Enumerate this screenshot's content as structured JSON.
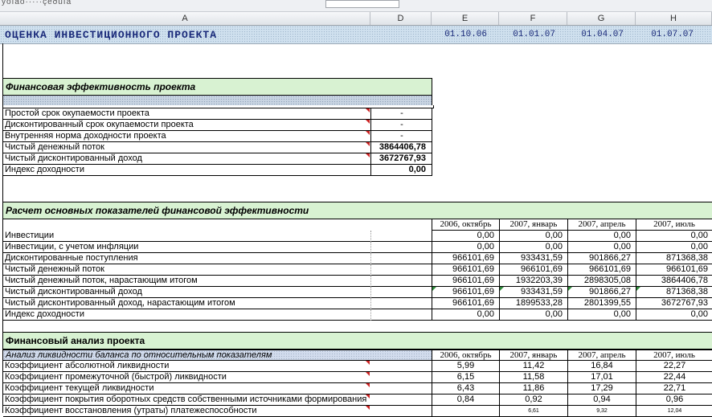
{
  "top_strip": {
    "dots": "ÿôíåô·····çèðûîå"
  },
  "column_headers": [
    {
      "id": "A",
      "label": "A"
    },
    {
      "id": "D",
      "label": "D"
    },
    {
      "id": "E",
      "label": "E"
    },
    {
      "id": "F",
      "label": "F"
    },
    {
      "id": "G",
      "label": "G"
    },
    {
      "id": "H",
      "label": "H"
    }
  ],
  "title_row": {
    "title": "ОЦЕНКА ИНВЕСТИЦИОННОГО ПРОЕКТА",
    "dates": [
      "01.10.06",
      "01.01.07",
      "01.04.07",
      "01.07.07"
    ]
  },
  "section1": {
    "heading": "Финансовая эффективность проекта",
    "rows": [
      {
        "label": "Простой срок окупаемости проекта",
        "value": "-"
      },
      {
        "label": "Дисконтированный срок окупаемости проекта",
        "value": "-"
      },
      {
        "label": "Внутренняя норма доходности проекта",
        "value": "-"
      },
      {
        "label": "Чистый денежный поток",
        "value": "3864406,78"
      },
      {
        "label": "Чистый дисконтированный доход",
        "value": "3672767,93"
      },
      {
        "label": "Индекс доходности",
        "value": "0,00"
      }
    ]
  },
  "section2": {
    "heading": "Расчет основных показателей финансовой эффективности",
    "periods": [
      "2006, октябрь",
      "2007, январь",
      "2007, апрель",
      "2007, июль"
    ],
    "rows": [
      {
        "label": "Инвестиции",
        "values": [
          "0,00",
          "0,00",
          "0,00",
          "0,00"
        ]
      },
      {
        "label": "Инвестиции, с учетом инфляции",
        "values": [
          "0,00",
          "0,00",
          "0,00",
          "0,00"
        ]
      },
      {
        "label": "Дисконтированные поступления",
        "values": [
          "966101,69",
          "933431,59",
          "901866,27",
          "871368,38"
        ]
      },
      {
        "label": "Чистый денежный поток",
        "values": [
          "966101,69",
          "966101,69",
          "966101,69",
          "966101,69"
        ]
      },
      {
        "label": "Чистый денежный поток, нарастающим итогом",
        "values": [
          "966101,69",
          "1932203,39",
          "2898305,08",
          "3864406,78"
        ]
      },
      {
        "label": "Чистый дисконтированный доход",
        "values": [
          "966101,69",
          "933431,59",
          "901866,27",
          "871368,38"
        ]
      },
      {
        "label": "Чистый дисконтированный доход, нарастающим итогом",
        "values": [
          "966101,69",
          "1899533,28",
          "2801399,55",
          "3672767,93"
        ]
      },
      {
        "label": "Индекс доходности",
        "values": [
          "0,00",
          "0,00",
          "0,00",
          "0,00"
        ]
      }
    ]
  },
  "section3": {
    "heading": "Финансовый анализ проекта",
    "subheading": "Анализ ликвидности баланса по относительным показателям",
    "periods": [
      "2006, октябрь",
      "2007, январь",
      "2007, апрель",
      "2007, июль"
    ],
    "rows": [
      {
        "label": "Коэффициент абсолютной ликвидности",
        "values": [
          "5,99",
          "11,42",
          "16,84",
          "22,27"
        ]
      },
      {
        "label": "Коэффициент промежуточной (быстрой) ликвидности",
        "values": [
          "6,15",
          "11,58",
          "17,01",
          "22,44"
        ]
      },
      {
        "label": "Коэффициент текущей ликвидности",
        "values": [
          "6,43",
          "11,86",
          "17,29",
          "22,71"
        ]
      },
      {
        "label": "Коэффициент покрытия оборотных средств собственными источниками формирования",
        "values": [
          "0,84",
          "0,92",
          "0,94",
          "0,96"
        ]
      },
      {
        "label": "Коэффициент восстановления (утраты) платежеспособности",
        "values": [
          "",
          "6,61",
          "9,32",
          "12,04"
        ]
      }
    ]
  }
}
